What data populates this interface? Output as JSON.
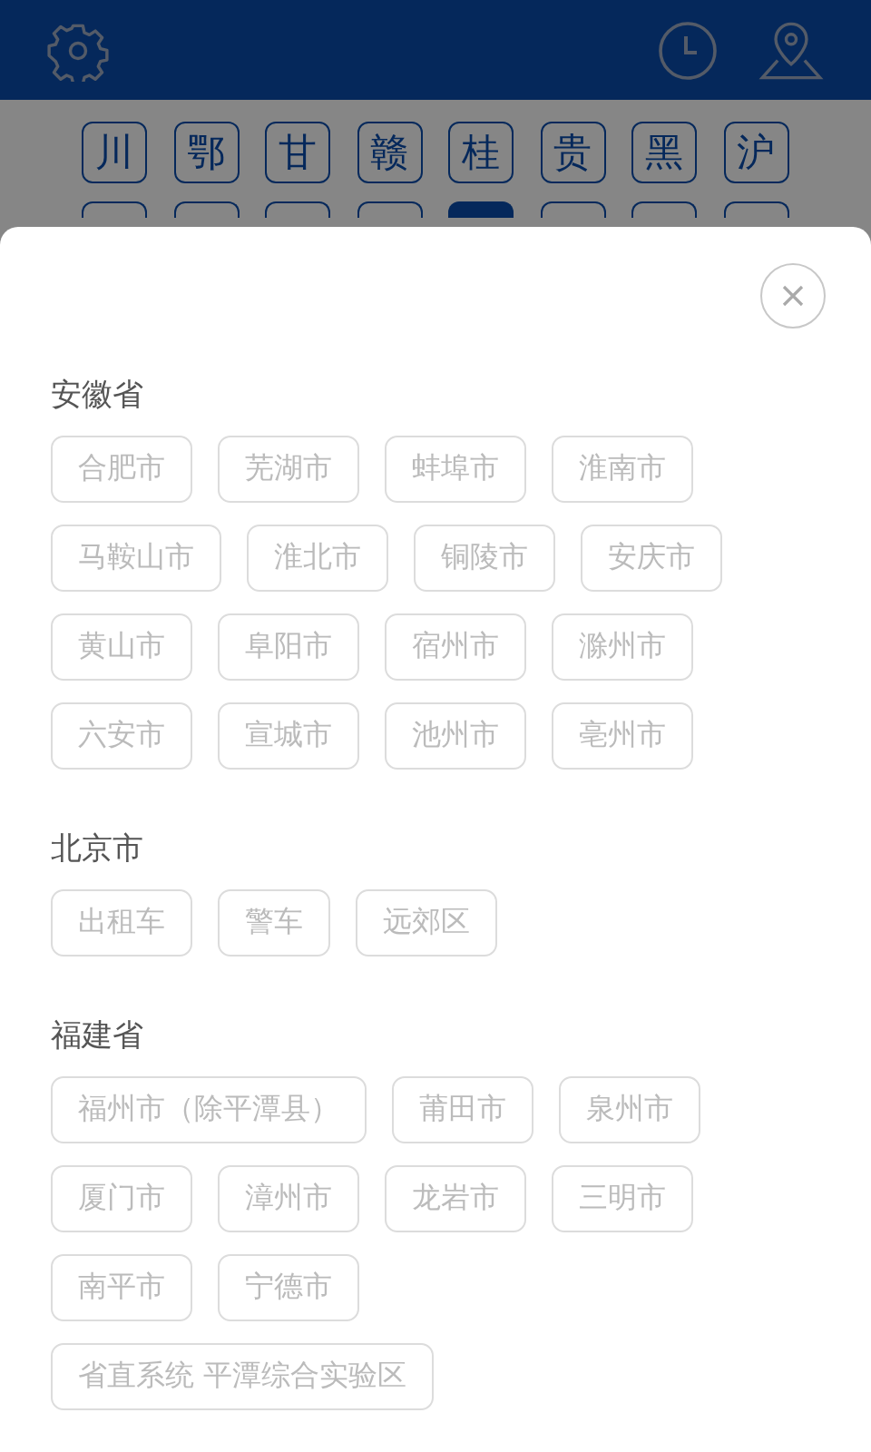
{
  "keyboard": {
    "keys": [
      {
        "label": "川",
        "selected": false
      },
      {
        "label": "鄂",
        "selected": false
      },
      {
        "label": "甘",
        "selected": false
      },
      {
        "label": "赣",
        "selected": false
      },
      {
        "label": "桂",
        "selected": false
      },
      {
        "label": "贵",
        "selected": false
      },
      {
        "label": "黑",
        "selected": false
      },
      {
        "label": "沪",
        "selected": false
      }
    ],
    "covered_keys": [
      {
        "selected": false
      },
      {
        "selected": false
      },
      {
        "selected": false
      },
      {
        "selected": false
      },
      {
        "selected": true
      },
      {
        "selected": false
      },
      {
        "selected": false
      },
      {
        "selected": false
      }
    ]
  },
  "sheet": {
    "sections": [
      {
        "title": "安徽省",
        "items": [
          "合肥市",
          "芜湖市",
          "蚌埠市",
          "淮南市",
          "马鞍山市",
          "淮北市",
          "铜陵市",
          "安庆市",
          "黄山市",
          "阜阳市",
          "宿州市",
          "滁州市",
          "六安市",
          "宣城市",
          "池州市",
          "亳州市"
        ]
      },
      {
        "title": "北京市",
        "items": [
          "出租车",
          "警车",
          "远郊区"
        ]
      },
      {
        "title": "福建省",
        "items": [
          "福州市（除平潭县）",
          "莆田市",
          "泉州市",
          "厦门市",
          "漳州市",
          "龙岩市",
          "三明市",
          "南平市",
          "宁德市",
          "省直系统 平潭综合实验区"
        ]
      }
    ]
  }
}
